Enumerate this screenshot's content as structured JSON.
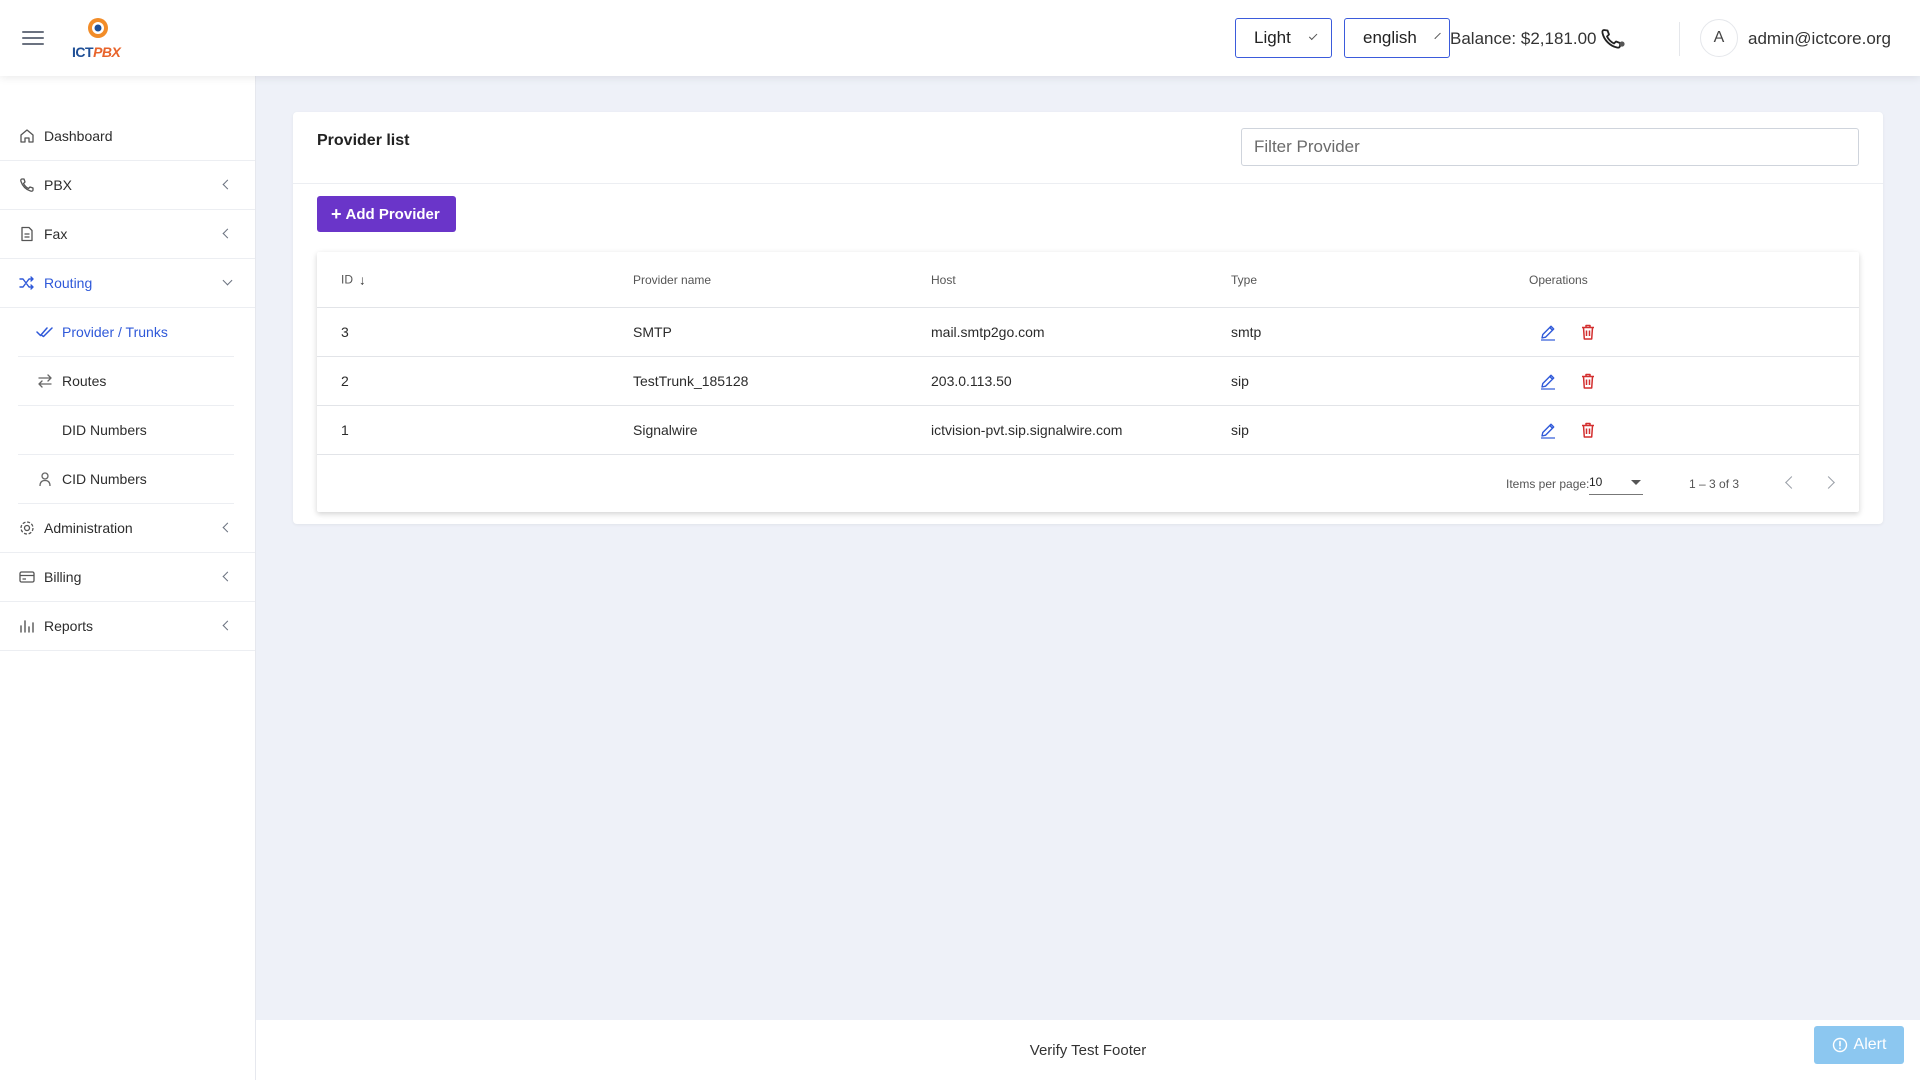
{
  "header": {
    "logo_text_a": "ICT",
    "logo_text_b": "PBX",
    "theme": "Light",
    "language": "english",
    "balance": "Balance: $2,181.00",
    "avatar_initial": "A",
    "user_email": "admin@ictcore.org"
  },
  "sidebar": {
    "items": [
      {
        "label": "Dashboard",
        "icon": "home-icon"
      },
      {
        "label": "PBX",
        "icon": "phone-icon"
      },
      {
        "label": "Fax",
        "icon": "document-icon"
      },
      {
        "label": "Routing",
        "icon": "shuffle-icon"
      },
      {
        "label": "Administration",
        "icon": "gear-icon"
      },
      {
        "label": "Billing",
        "icon": "credit-card-icon"
      },
      {
        "label": "Reports",
        "icon": "bar-chart-icon"
      }
    ],
    "routing_sub": [
      {
        "label": "Provider / Trunks",
        "icon": "double-check-icon"
      },
      {
        "label": "Routes",
        "icon": "swap-arrows-icon"
      },
      {
        "label": "DID Numbers",
        "icon": ""
      },
      {
        "label": "CID Numbers",
        "icon": "person-icon"
      }
    ]
  },
  "main": {
    "title": "Provider list",
    "filter_placeholder": "Filter Provider",
    "add_button": "Add Provider",
    "table": {
      "columns": [
        "ID",
        "Provider name",
        "Host",
        "Type",
        "Operations"
      ],
      "rows": [
        {
          "id": "3",
          "name": "SMTP",
          "host": "mail.smtp2go.com",
          "type": "smtp"
        },
        {
          "id": "2",
          "name": "TestTrunk_185128",
          "host": "203.0.113.50",
          "type": "sip"
        },
        {
          "id": "1",
          "name": "Signalwire",
          "host": "ictvision-pvt.sip.signalwire.com",
          "type": "sip"
        }
      ]
    },
    "paginator": {
      "items_per_page_label": "Items per page:",
      "items_per_page": "10",
      "range": "1 – 3 of 3"
    }
  },
  "footer": {
    "text": "Verify Test Footer",
    "alert_label": "Alert"
  },
  "colors": {
    "accent_blue": "#2f59d9",
    "add_button_purple": "#6a35c9",
    "delete_red": "#d32f2f",
    "alert_blue": "#8cc7f0"
  }
}
